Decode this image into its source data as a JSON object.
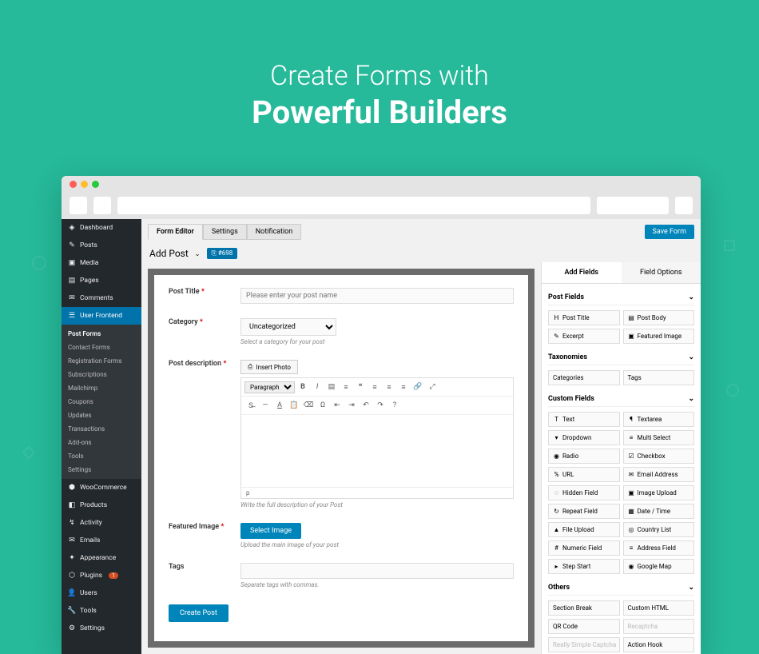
{
  "hero": {
    "line1": "Create Forms with",
    "line2": "Powerful Builders"
  },
  "sidebar": {
    "items": [
      {
        "icon": "◈",
        "label": "Dashboard"
      },
      {
        "icon": "✎",
        "label": "Posts"
      },
      {
        "icon": "▣",
        "label": "Media"
      },
      {
        "icon": "▤",
        "label": "Pages"
      },
      {
        "icon": "✉",
        "label": "Comments"
      },
      {
        "icon": "☰",
        "label": "User Frontend"
      }
    ],
    "sub": [
      "Post Forms",
      "Contact Forms",
      "Registration Forms",
      "Subscriptions",
      "Mailchimp",
      "Coupons",
      "Updates",
      "Transactions",
      "Add-ons",
      "Tools",
      "Settings"
    ],
    "items2": [
      {
        "icon": "⬢",
        "label": "WooCommerce"
      },
      {
        "icon": "◧",
        "label": "Products"
      },
      {
        "icon": "↯",
        "label": "Activity"
      },
      {
        "icon": "✉",
        "label": "Emails"
      },
      {
        "icon": "✦",
        "label": "Appearance"
      },
      {
        "icon": "⬡",
        "label": "Plugins",
        "badge": "1"
      },
      {
        "icon": "👤",
        "label": "Users"
      },
      {
        "icon": "🔧",
        "label": "Tools"
      },
      {
        "icon": "⚙",
        "label": "Settings"
      }
    ]
  },
  "tabs": [
    "Form Editor",
    "Settings",
    "Notification"
  ],
  "save": "Save Form",
  "pageTitle": "Add Post",
  "codeChip": "⎘ #698",
  "form": {
    "title": {
      "label": "Post Title",
      "ph": "Please enter your post name"
    },
    "category": {
      "label": "Category",
      "value": "Uncategorized",
      "help": "Select a category for your post"
    },
    "desc": {
      "label": "Post description",
      "insert": "Insert Photo",
      "para": "Paragraph",
      "status": "p",
      "help": "Write the full description of your Post"
    },
    "featured": {
      "label": "Featured Image",
      "btn": "Select Image",
      "help": "Upload the main image of your post"
    },
    "tags": {
      "label": "Tags",
      "help": "Separate tags with commas."
    },
    "submit": "Create Post"
  },
  "right": {
    "tabs": [
      "Add Fields",
      "Field Options"
    ],
    "sections": [
      {
        "title": "Post Fields",
        "fields": [
          {
            "i": "H",
            "l": "Post Title"
          },
          {
            "i": "▤",
            "l": "Post Body"
          },
          {
            "i": "✎",
            "l": "Excerpt"
          },
          {
            "i": "▣",
            "l": "Featured Image"
          }
        ]
      },
      {
        "title": "Taxonomies",
        "fields": [
          {
            "i": "",
            "l": "Categories"
          },
          {
            "i": "",
            "l": "Tags"
          }
        ]
      },
      {
        "title": "Custom Fields",
        "fields": [
          {
            "i": "T",
            "l": "Text"
          },
          {
            "i": "¶",
            "l": "Textarea"
          },
          {
            "i": "▾",
            "l": "Dropdown"
          },
          {
            "i": "≡",
            "l": "Multi Select"
          },
          {
            "i": "◉",
            "l": "Radio"
          },
          {
            "i": "☑",
            "l": "Checkbox"
          },
          {
            "i": "%",
            "l": "URL"
          },
          {
            "i": "✉",
            "l": "Email Address"
          },
          {
            "i": "◌",
            "l": "Hidden Field"
          },
          {
            "i": "▣",
            "l": "Image Upload"
          },
          {
            "i": "↻",
            "l": "Repeat Field"
          },
          {
            "i": "▦",
            "l": "Date / Time"
          },
          {
            "i": "▲",
            "l": "File Upload"
          },
          {
            "i": "◎",
            "l": "Country List"
          },
          {
            "i": "#",
            "l": "Numeric Field"
          },
          {
            "i": "≡",
            "l": "Address Field"
          },
          {
            "i": "▸",
            "l": "Step Start"
          },
          {
            "i": "◉",
            "l": "Google Map"
          }
        ]
      },
      {
        "title": "Others",
        "fields": [
          {
            "i": "",
            "l": "Section Break"
          },
          {
            "i": "",
            "l": "Custom HTML"
          },
          {
            "i": "",
            "l": "QR Code"
          },
          {
            "i": "",
            "l": "Recaptcha",
            "d": true
          },
          {
            "i": "",
            "l": "Really Simple Captcha",
            "d": true
          },
          {
            "i": "",
            "l": "Action Hook"
          }
        ]
      }
    ]
  }
}
